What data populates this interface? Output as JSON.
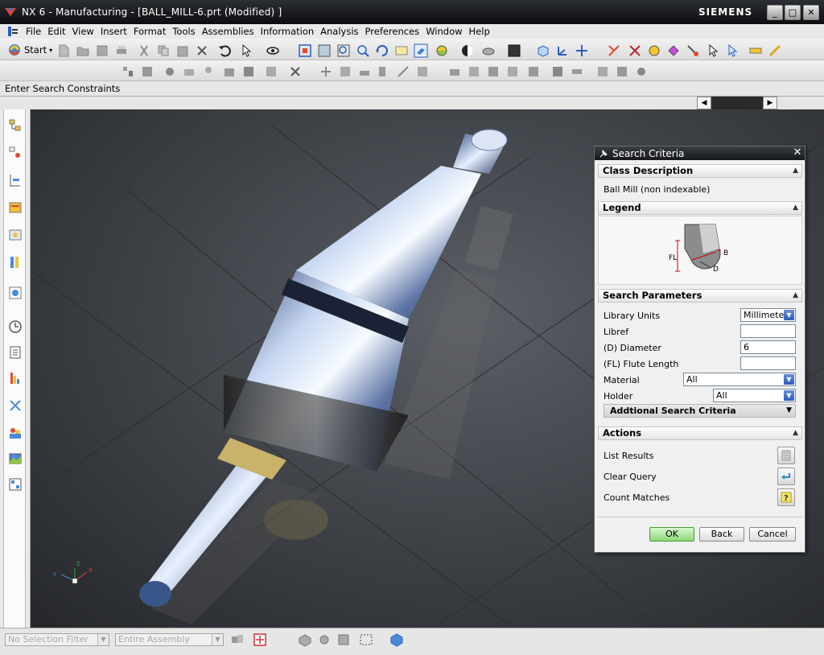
{
  "window": {
    "title": "NX 6 - Manufacturing - [BALL_MILL-6.prt (Modified) ]",
    "brand": "SIEMENS",
    "controls": {
      "minimize": "_",
      "maximize": "□",
      "close": "✕"
    }
  },
  "menu": {
    "items": [
      "File",
      "Edit",
      "View",
      "Insert",
      "Format",
      "Tools",
      "Assemblies",
      "Information",
      "Analysis",
      "Preferences",
      "Window",
      "Help"
    ]
  },
  "toolbar": {
    "start_label": "Start"
  },
  "cue_line": {
    "text": "Enter Search Constraints"
  },
  "bottom": {
    "selection_filter": "No Selection Filter",
    "scope": "Entire Assembly"
  },
  "dialog": {
    "title": "Search Criteria",
    "class_description": {
      "header": "Class Description",
      "value": "Ball Mill (non indexable)"
    },
    "legend": {
      "header": "Legend",
      "labels": {
        "fl": "FL",
        "b": "B",
        "d": "D"
      }
    },
    "search_parameters": {
      "header": "Search Parameters",
      "library_units": {
        "label": "Library Units",
        "value": "Millimeter"
      },
      "libref": {
        "label": "Libref",
        "value": ""
      },
      "diameter": {
        "label": "(D) Diameter",
        "value": "6"
      },
      "flute_length": {
        "label": "(FL) Flute Length",
        "value": ""
      },
      "material": {
        "label": "Material",
        "value": "All"
      },
      "holder": {
        "label": "Holder",
        "value": "All"
      },
      "additional": "Addtional Search Criteria"
    },
    "actions": {
      "header": "Actions",
      "list_results": "List Results",
      "clear_query": "Clear Query",
      "count_matches": "Count Matches"
    },
    "buttons": {
      "ok": "OK",
      "back": "Back",
      "cancel": "Cancel"
    }
  },
  "colors": {
    "title_bar": "#16181b",
    "viewport": "#3c3f44",
    "ok_button": "#8fd87a",
    "dropdown_accent": "#2e5ab8"
  }
}
